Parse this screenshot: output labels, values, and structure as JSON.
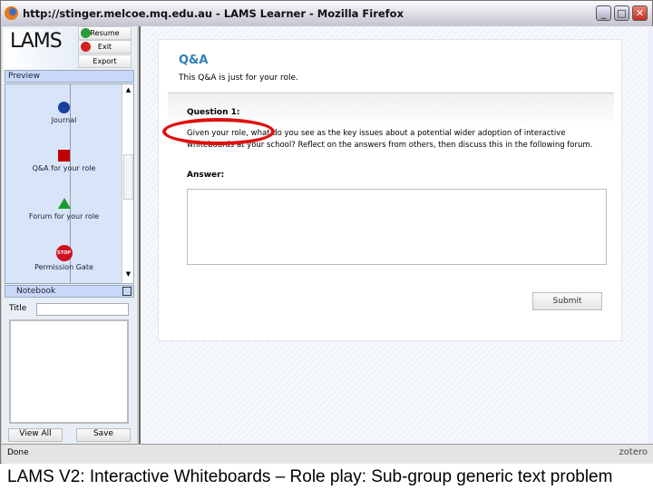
{
  "window": {
    "title": "http://stinger.melcoe.mq.edu.au - LAMS Learner - Mozilla Firefox",
    "minimize": "_",
    "maximize": "□",
    "close": "✕"
  },
  "sidebar": {
    "logo": "LAMS",
    "resume": "Resume",
    "exit": "Exit",
    "export": "Export",
    "preview_label": "Preview",
    "activities": [
      {
        "label": "Journal",
        "shape": "circle",
        "color": "#1a3fa0"
      },
      {
        "label": "Q&A for your role",
        "shape": "square",
        "color": "#c00000"
      },
      {
        "label": "Forum for your role",
        "shape": "triangle",
        "color": "#1a9a2a"
      },
      {
        "label": "Permission Gate",
        "shape": "stop",
        "color": "#d01020",
        "stop_text": "STOP"
      }
    ],
    "notebook_label": "Notebook",
    "title_label": "Title",
    "title_value": "",
    "body_value": "",
    "view_all": "View All",
    "save": "Save"
  },
  "main": {
    "heading": "Q&A",
    "intro": "This Q&A is just for your role.",
    "question_label": "Question 1:",
    "question_text": "Given your role, what do you see as the key issues about a potential wider adoption of interactive whiteboards at your school? Reflect on the answers from others, then discuss this in the following forum.",
    "answer_label": "Answer:",
    "answer_value": "",
    "submit": "Submit",
    "accent": "#2f7fb5"
  },
  "status": {
    "text": "Done",
    "brand": "zotero"
  },
  "caption": "LAMS V2: Interactive Whiteboards – Role play: Sub-group generic text problem"
}
